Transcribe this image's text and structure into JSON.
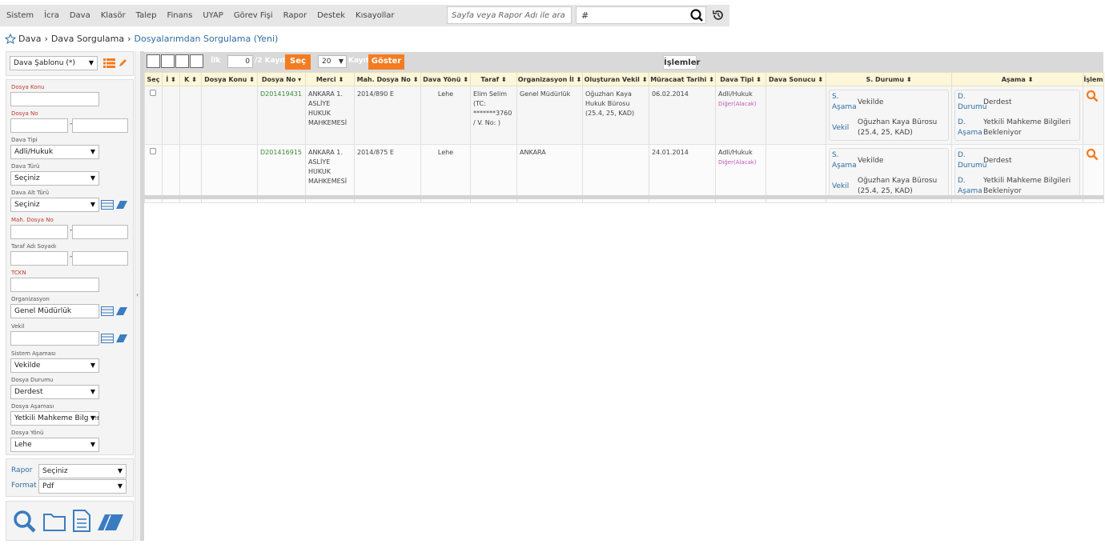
{
  "topbar": {
    "menu": [
      "Sistem",
      "İcra",
      "Dava",
      "Klasör",
      "Talep",
      "Finans",
      "UYAP",
      "Görev Fişi",
      "Rapor",
      "Destek",
      "Kısayollar"
    ],
    "search_placeholder": "Sayfa veya Rapor Adı ile ara",
    "hash_value": "#"
  },
  "breadcrumb": {
    "items": [
      "Dava",
      "Dava Sorgulama"
    ],
    "current": "Dosyalarımdan Sorgulama (Yeni)"
  },
  "sidebar": {
    "template_select": "Dava Şablonu (*)",
    "fields": {
      "dosya_konu": "Dosya Konu",
      "dosya_no": "Dosya No",
      "dava_tipi": "Dava Tipi",
      "dava_tipi_value": "Adli/Hukuk",
      "dava_turu": "Dava Türü",
      "dava_turu_value": "Seçiniz",
      "dava_alt_turu": "Dava Alt Türü",
      "dava_alt_turu_value": "Seçiniz",
      "mah_dosya_no": "Mah. Dosya No",
      "taraf_adi": "Taraf Adı Soyadı",
      "tckn": "TCKN",
      "organizasyon": "Organizasyon",
      "organizasyon_value": "Genel Müdürlük",
      "vekil": "Vekil",
      "sistem_asamasi": "Sistem Aşaması",
      "sistem_asamasi_value": "Vekilde",
      "dosya_durumu": "Dosya Durumu",
      "dosya_durumu_value": "Derdest",
      "dosya_asamasi": "Dosya Aşaması",
      "dosya_asamasi_value": "Yetkili Mahkeme Bilgileri Bekleniyor",
      "dosya_yonu": "Dosya Yönü",
      "dosya_yonu_value": "Lehe"
    },
    "report": {
      "rapor_label": "Rapor",
      "rapor_value": "Seçiniz",
      "format_label": "Format",
      "format_value": "Pdf"
    }
  },
  "grid": {
    "toolbar": {
      "ilk": "İlk",
      "ilk_value": "0",
      "kayit_prefix": "/2 Kayıt",
      "sec": "Seç",
      "count_value": "20",
      "kayit2": "Kayıt",
      "goster": "Göster",
      "islemler": "İşlemler"
    },
    "headers": [
      "Seç",
      "İ ⬍",
      "K ⬍",
      "Dosya Konu ⬍",
      "Dosya No ▾",
      "Merci ⬍",
      "Mah. Dosya No ⬍",
      "Dava Yönü ⬍",
      "Taraf ⬍",
      "Organizasyon İl ⬍",
      "Oluşturan Vekil ⬍",
      "Müracaat Tarihi ⬍",
      "Dava Tipi ⬍",
      "Dava Sonucu ⬍",
      "S. Durumu ⬍",
      "Aşama ⬍",
      "İşlem"
    ],
    "rows": [
      {
        "dosya_no": "D201419431",
        "merci": "ANKARA 1. ASLİYE HUKUK MAHKEMESİ",
        "mah_dosya_no": "2014/890 E",
        "dava_yonu": "Lehe",
        "taraf": "Elim Selim (TC: *******3760 / V. No: )",
        "organizasyon": "Genel Müdürlük",
        "vekil": "Oğuzhan Kaya Hukuk Bürosu (25.4, 25, KAD)",
        "tarih": "06.02.2014",
        "dava_tipi": "Adli/Hukuk",
        "dava_tipi_sub": "Diğer(Alacak)",
        "s_asama_k": "S. Aşama",
        "s_asama_v": "Vekilde",
        "vekil_k": "Vekil",
        "vekil_v": "Oğuzhan Kaya Bürosu (25.4, 25, KAD)",
        "d_durumu_k": "D. Durumu",
        "d_durumu_v": "Derdest",
        "d_asama_k": "D. Aşama",
        "d_asama_v": "Yetkili Mahkeme Bilgileri Bekleniyor"
      },
      {
        "dosya_no": "D201416915",
        "merci": "ANKARA 1. ASLİYE HUKUK MAHKEMESİ",
        "mah_dosya_no": "2014/875 E",
        "dava_yonu": "Lehe",
        "taraf": "",
        "organizasyon": "ANKARA",
        "vekil": "",
        "tarih": "24.01.2014",
        "dava_tipi": "Adli/Hukuk",
        "dava_tipi_sub": "Diğer(Alacak)",
        "s_asama_k": "S. Aşama",
        "s_asama_v": "Vekilde",
        "vekil_k": "Vekil",
        "vekil_v": "Oğuzhan Kaya Bürosu (25.4, 25, KAD)",
        "d_durumu_k": "D. Durumu",
        "d_durumu_v": "Derdest",
        "d_asama_k": "D. Aşama",
        "d_asama_v": "Yetkili Mahkeme Bilgileri Bekleniyor"
      }
    ]
  },
  "colors": {
    "accent": "#f47c20",
    "link": "#2e6da4",
    "header_bg": "#fdf6d8"
  }
}
